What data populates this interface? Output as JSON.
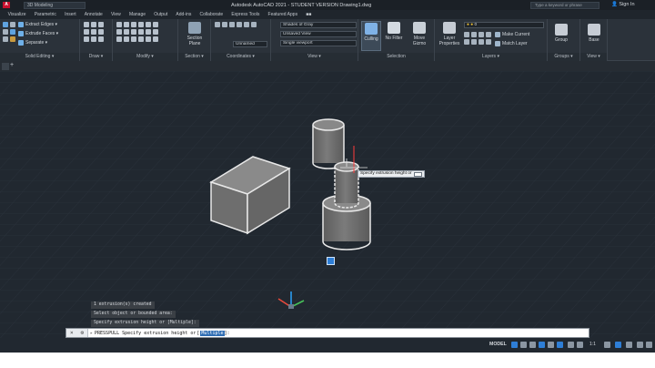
{
  "titlebar": {
    "logo": "A",
    "workspace": "3D Modeling",
    "title": "Autodesk AutoCAD 2021 - STUDENT VERSION   Drawing1.dwg",
    "search_placeholder": "Type a keyword or phrase",
    "user": "Sign In"
  },
  "ribbon_tabs": [
    "Visualize",
    "Parametric",
    "Insert",
    "Annotate",
    "View",
    "Manage",
    "Output",
    "Add-ins",
    "Collaborate",
    "Express Tools",
    "Featured Apps",
    "■■"
  ],
  "ribbon": {
    "solid_editing": {
      "title": "Solid Editing ▾",
      "items": [
        "Extract Edges ▾",
        "Extrude Faces ▾",
        "Separate ▾"
      ]
    },
    "draw": {
      "title": "Draw ▾"
    },
    "modify": {
      "title": "Modify ▾"
    },
    "section": {
      "title": "Section ▾",
      "big_label_1": "Section",
      "big_label_2": "Plane"
    },
    "coordinates": {
      "title": "Coordinates ▾",
      "ucs_value": "Unnamed",
      "world": "World"
    },
    "view": {
      "title": "View ▾",
      "visual_style": "Shades of Gray",
      "named_view": "Unsaved View",
      "viewport": "Single viewport"
    },
    "selection": {
      "title": "Selection",
      "culling": "Culling",
      "no_filter_1": "No Filter",
      "move_1": "Move",
      "move_2": "Gizmo"
    },
    "layers": {
      "title": "Layers ▾",
      "layer_prop_1": "Layer",
      "layer_prop_2": "Properties",
      "layer_value": "0",
      "make_current": "Make Current",
      "match_layer": "Match Layer"
    },
    "groups": {
      "title": "Groups ▾",
      "group": "Group"
    },
    "view2": {
      "title": "View ▾",
      "base": "Base"
    }
  },
  "viewport": {
    "tooltip_text": "Specify extrusion height or"
  },
  "command": {
    "history": [
      "1 extrusion(s) created",
      "Select object or bounded area:",
      "Specify extrusion height or [Multiple]:"
    ],
    "current_prefix": "PRESSPULL Specify extrusion height or",
    "current_option": "Multiple",
    "current_suffix": "]:"
  },
  "statusbar": {
    "model": "MODEL",
    "scale": "1:1"
  },
  "colors": {
    "accent": "#2e7ed6",
    "viewport_bg": "#212830",
    "solid_fill": "#6d6d6d"
  }
}
